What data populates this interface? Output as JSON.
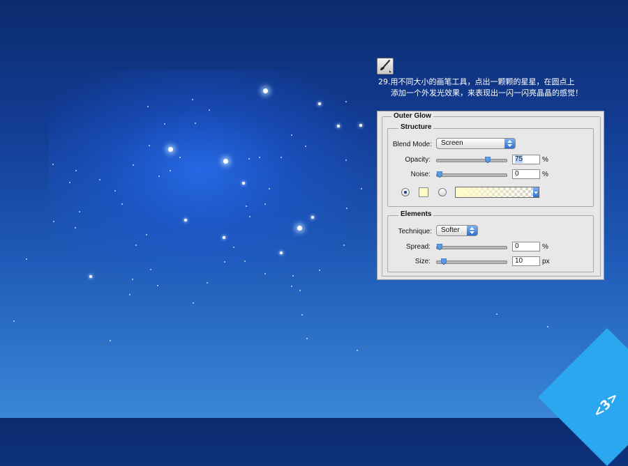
{
  "tutorial": {
    "step_line1": "29.用不同大小的画笔工具，点出一颗颗的星星，在圆点上",
    "step_line2": "添加一个外发光效果，来表现出一闪一闪亮晶晶的感觉！",
    "tool_icon": "brush-icon"
  },
  "outer_glow": {
    "title": "Outer Glow",
    "structure": {
      "legend": "Structure",
      "blend_mode_label": "Blend Mode:",
      "blend_mode_value": "Screen",
      "opacity_label": "Opacity:",
      "opacity_value": "75",
      "opacity_unit": "%",
      "opacity_level": 75,
      "noise_label": "Noise:",
      "noise_value": "0",
      "noise_unit": "%",
      "noise_level": 0,
      "glow_color": "#fffbc8"
    },
    "elements": {
      "legend": "Elements",
      "technique_label": "Technique:",
      "technique_value": "Softer",
      "spread_label": "Spread:",
      "spread_value": "0",
      "spread_unit": "%",
      "spread_level": 0,
      "size_label": "Size:",
      "size_value": "10",
      "size_unit": "px"
    }
  },
  "page_number": "<3>"
}
